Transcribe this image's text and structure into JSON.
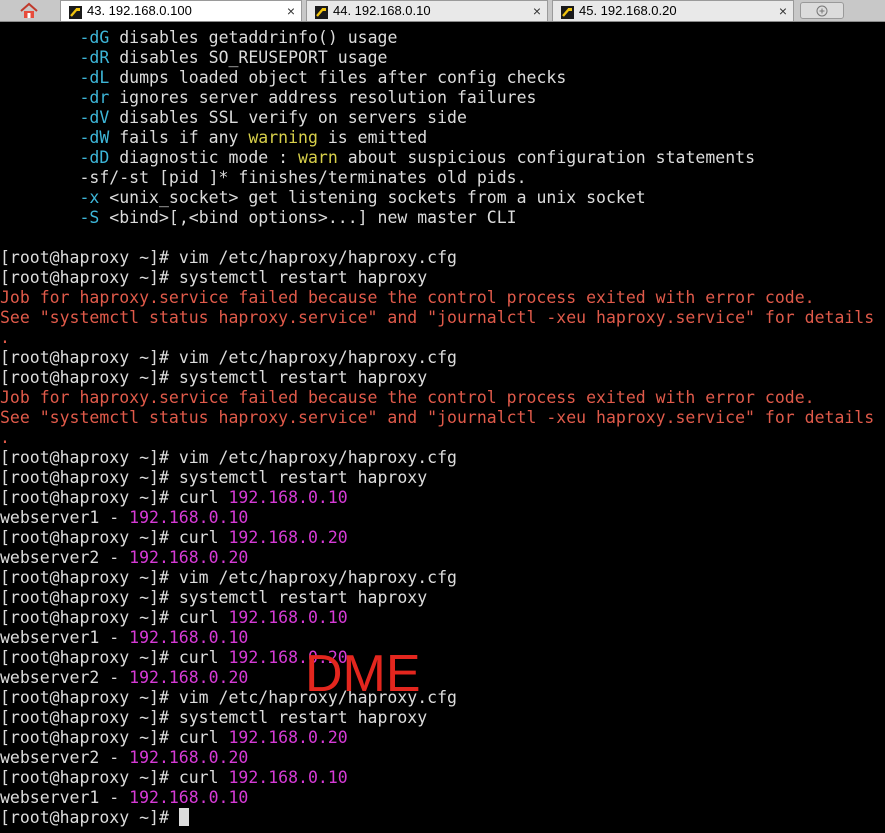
{
  "tabs": [
    {
      "label": "43. 192.168.0.100",
      "state": "active"
    },
    {
      "label": "44. 192.168.0.10",
      "state": "inactive"
    },
    {
      "label": "45. 192.168.0.20",
      "state": "inactive"
    }
  ],
  "tab_close_glyph": "×",
  "icons": {
    "home": "home-icon",
    "tab": "terminal-icon",
    "new_tab": "new-tab-icon"
  },
  "colors": {
    "cyan": "#3db6d8",
    "yellow": "#d8d04a",
    "red": "#e05a4a",
    "magenta": "#d63bd6",
    "text": "#dcdcdc"
  },
  "terminal": {
    "help": [
      {
        "flag": "-dG",
        "text": " disables getaddrinfo() usage"
      },
      {
        "flag": "-dR",
        "text": " disables SO_REUSEPORT usage"
      },
      {
        "flag": "-dL",
        "text": " dumps loaded object files after config checks"
      },
      {
        "flag": "-dr",
        "text": " ignores server address resolution failures"
      },
      {
        "flag": "-dV",
        "text": " disables SSL verify on servers side"
      },
      {
        "flag": "-dW",
        "pre": " fails if any ",
        "hl": "warning",
        "post": " is emitted"
      },
      {
        "flag": "-dD",
        "pre": " diagnostic mode : ",
        "hl": "warn",
        "post": " about suspicious configuration statements"
      },
      {
        "plain": "-sf/-st [pid ]* finishes/terminates old pids."
      },
      {
        "flag": "-x",
        "text": " <unix_socket> get listening sockets from a unix socket"
      },
      {
        "flag": "-S",
        "text": " <bind>[,<bind options>...] new master CLI"
      }
    ],
    "prompt": "[root@haproxy ~]# ",
    "cmd_vim": "vim /etc/haproxy/haproxy.cfg",
    "cmd_restart": "systemctl restart haproxy",
    "cmd_curl": "curl ",
    "ip10": "192.168.0.10",
    "ip20": "192.168.0.20",
    "err1": "Job for haproxy.service failed because the control process exited with error code.",
    "err2": "See \"systemctl status haproxy.service\" and \"journalctl -xeu haproxy.service\" for details",
    "err3": ".",
    "ws1": "webserver1 - ",
    "ws2": "webserver2 - "
  },
  "watermark": "DME"
}
